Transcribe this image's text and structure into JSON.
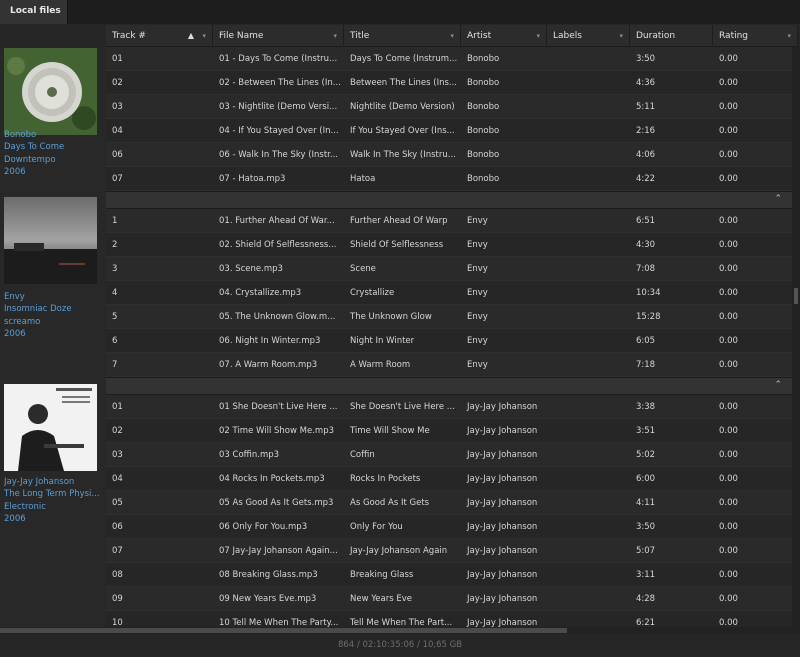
{
  "tab": {
    "label": "Local files"
  },
  "columns": [
    {
      "label": "Track #",
      "sorted": "ascending"
    },
    {
      "label": "File Name"
    },
    {
      "label": "Title"
    },
    {
      "label": "Artist"
    },
    {
      "label": "Labels"
    },
    {
      "label": "Duration"
    },
    {
      "label": "Rating"
    }
  ],
  "groups": [
    {
      "artist": "Bonobo",
      "album": "Days To Come",
      "genre": "Downtempo",
      "year": "2006",
      "tracks": [
        {
          "track": "01",
          "file": "01 - Days To Come (Instru...",
          "title": "Days To Come (Instrum...",
          "artist": "Bonobo",
          "labels": "",
          "duration": "3:50",
          "rating": "0.00"
        },
        {
          "track": "02",
          "file": "02 - Between The Lines (In...",
          "title": "Between The Lines (Ins...",
          "artist": "Bonobo",
          "labels": "",
          "duration": "4:36",
          "rating": "0.00"
        },
        {
          "track": "03",
          "file": "03 - Nightlite (Demo Versi...",
          "title": "Nightlite (Demo Version)",
          "artist": "Bonobo",
          "labels": "",
          "duration": "5:11",
          "rating": "0.00"
        },
        {
          "track": "04",
          "file": "04 - If You Stayed Over (In...",
          "title": "If You Stayed Over (Ins...",
          "artist": "Bonobo",
          "labels": "",
          "duration": "2:16",
          "rating": "0.00"
        },
        {
          "track": "06",
          "file": "06 - Walk In The Sky (Instr...",
          "title": "Walk In The Sky (Instru...",
          "artist": "Bonobo",
          "labels": "",
          "duration": "4:06",
          "rating": "0.00"
        },
        {
          "track": "07",
          "file": "07 - Hatoa.mp3",
          "title": "Hatoa",
          "artist": "Bonobo",
          "labels": "",
          "duration": "4:22",
          "rating": "0.00"
        }
      ]
    },
    {
      "artist": "Envy",
      "album": "Insomniac Doze",
      "genre": "screamo",
      "year": "2006",
      "tracks": [
        {
          "track": "1",
          "file": "01. Further Ahead Of War...",
          "title": "Further Ahead Of Warp",
          "artist": "Envy",
          "labels": "",
          "duration": "6:51",
          "rating": "0.00"
        },
        {
          "track": "2",
          "file": "02. Shield Of Selflessness...",
          "title": "Shield Of Selflessness",
          "artist": "Envy",
          "labels": "",
          "duration": "4:30",
          "rating": "0.00"
        },
        {
          "track": "3",
          "file": "03. Scene.mp3",
          "title": "Scene",
          "artist": "Envy",
          "labels": "",
          "duration": "7:08",
          "rating": "0.00"
        },
        {
          "track": "4",
          "file": "04. Crystallize.mp3",
          "title": "Crystallize",
          "artist": "Envy",
          "labels": "",
          "duration": "10:34",
          "rating": "0.00"
        },
        {
          "track": "5",
          "file": "05. The Unknown Glow.m...",
          "title": "The Unknown Glow",
          "artist": "Envy",
          "labels": "",
          "duration": "15:28",
          "rating": "0.00"
        },
        {
          "track": "6",
          "file": "06. Night In Winter.mp3",
          "title": "Night In Winter",
          "artist": "Envy",
          "labels": "",
          "duration": "6:05",
          "rating": "0.00"
        },
        {
          "track": "7",
          "file": "07. A Warm Room.mp3",
          "title": "A Warm Room",
          "artist": "Envy",
          "labels": "",
          "duration": "7:18",
          "rating": "0.00"
        }
      ]
    },
    {
      "artist": "Jay-Jay Johanson",
      "album": "The Long Term Physi...",
      "genre": "Electronic",
      "year": "2006",
      "tracks": [
        {
          "track": "01",
          "file": "01 She Doesn't Live Here ...",
          "title": "She Doesn't Live Here ...",
          "artist": "Jay-Jay Johanson",
          "labels": "",
          "duration": "3:38",
          "rating": "0.00"
        },
        {
          "track": "02",
          "file": "02 Time Will Show Me.mp3",
          "title": "Time Will Show Me",
          "artist": "Jay-Jay Johanson",
          "labels": "",
          "duration": "3:51",
          "rating": "0.00"
        },
        {
          "track": "03",
          "file": "03 Coffin.mp3",
          "title": "Coffin",
          "artist": "Jay-Jay Johanson",
          "labels": "",
          "duration": "5:02",
          "rating": "0.00"
        },
        {
          "track": "04",
          "file": "04 Rocks In Pockets.mp3",
          "title": "Rocks In Pockets",
          "artist": "Jay-Jay Johanson",
          "labels": "",
          "duration": "6:00",
          "rating": "0.00"
        },
        {
          "track": "05",
          "file": "05 As Good As It Gets.mp3",
          "title": "As Good As It Gets",
          "artist": "Jay-Jay Johanson",
          "labels": "",
          "duration": "4:11",
          "rating": "0.00"
        },
        {
          "track": "06",
          "file": "06 Only For You.mp3",
          "title": "Only For You",
          "artist": "Jay-Jay Johanson",
          "labels": "",
          "duration": "3:50",
          "rating": "0.00"
        },
        {
          "track": "07",
          "file": "07 Jay-Jay Johanson Again...",
          "title": "Jay-Jay Johanson Again",
          "artist": "Jay-Jay Johanson",
          "labels": "",
          "duration": "5:07",
          "rating": "0.00"
        },
        {
          "track": "08",
          "file": "08 Breaking Glass.mp3",
          "title": "Breaking Glass",
          "artist": "Jay-Jay Johanson",
          "labels": "",
          "duration": "3:11",
          "rating": "0.00"
        },
        {
          "track": "09",
          "file": "09 New Years Eve.mp3",
          "title": "New Years Eve",
          "artist": "Jay-Jay Johanson",
          "labels": "",
          "duration": "4:28",
          "rating": "0.00"
        },
        {
          "track": "10",
          "file": "10 Tell Me When The Party...",
          "title": "Tell Me When The Part...",
          "artist": "Jay-Jay Johanson",
          "labels": "",
          "duration": "6:21",
          "rating": "0.00"
        }
      ]
    }
  ],
  "status": {
    "text": "864 / 02:10:35:06 / 10,65 GB"
  },
  "colors": {
    "link": "#5c9fd6",
    "background": "#262626"
  },
  "icons": {
    "collapse": "collapse-up-icon",
    "sort": "sort-ascending-icon",
    "filter": "filter-icon"
  }
}
